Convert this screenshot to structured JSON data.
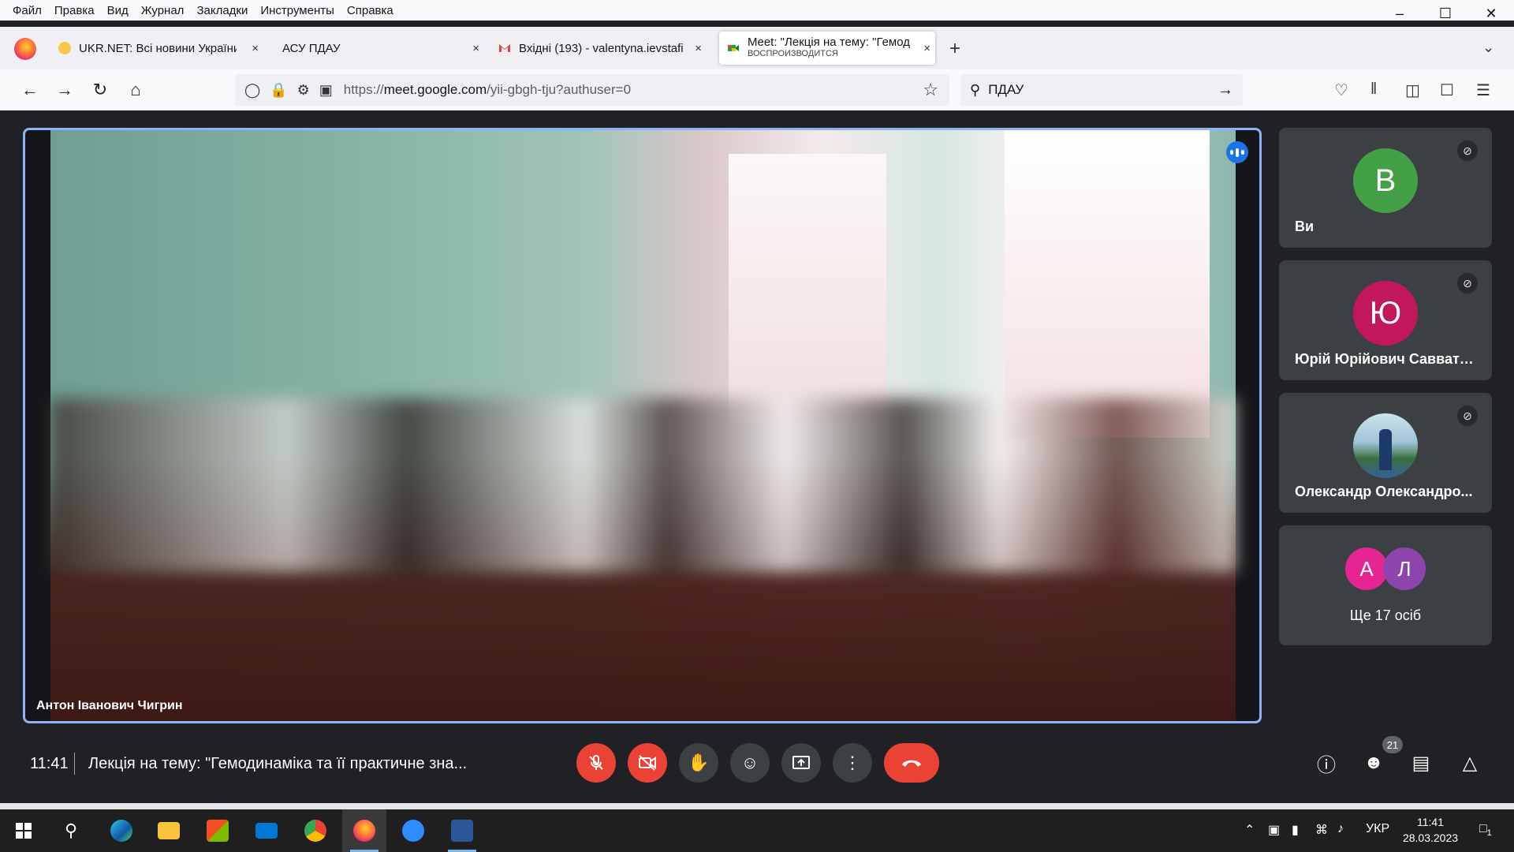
{
  "browser": {
    "menu": [
      "Файл",
      "Правка",
      "Вид",
      "Журнал",
      "Закладки",
      "Инструменты",
      "Справка"
    ],
    "tabs": [
      {
        "title": "UKR.NET: Всі новини України, ",
        "close": "×"
      },
      {
        "title": "АСУ ПДАУ",
        "close": "×"
      },
      {
        "title": "Вхідні (193) - valentyna.ievstafi",
        "close": "×"
      },
      {
        "title": "Meet: \"Лекція на тему: \"Гемод",
        "subtitle": "ВОСПРОИЗВОДИТСЯ",
        "close": "×"
      }
    ],
    "url_prefix": "https://",
    "url_host": "meet.google.com",
    "url_path": "/yii-gbgh-tju?authuser=0",
    "search_text": "ПДАУ"
  },
  "meet": {
    "main_speaker": "Антон Іванович Чигрин",
    "participants": [
      {
        "initial": "В",
        "name": "Ви",
        "color": "#43a047"
      },
      {
        "initial": "Ю",
        "name": "Юрій Юрійович Савватєєв",
        "color": "#c2185b"
      },
      {
        "name": "Олександр Олександро..."
      }
    ],
    "others": {
      "initials": [
        "А",
        "Л"
      ],
      "colors": [
        "#e52592",
        "#8e44ad"
      ],
      "label": "Ще 17 осіб"
    },
    "time": "11:41",
    "meeting_title": "Лекція на тему: \"Гемодинаміка та її практичне зна...",
    "participant_count": "21"
  },
  "taskbar": {
    "lang": "УКР",
    "time": "11:41",
    "date": "28.03.2023",
    "notifications": "1"
  }
}
